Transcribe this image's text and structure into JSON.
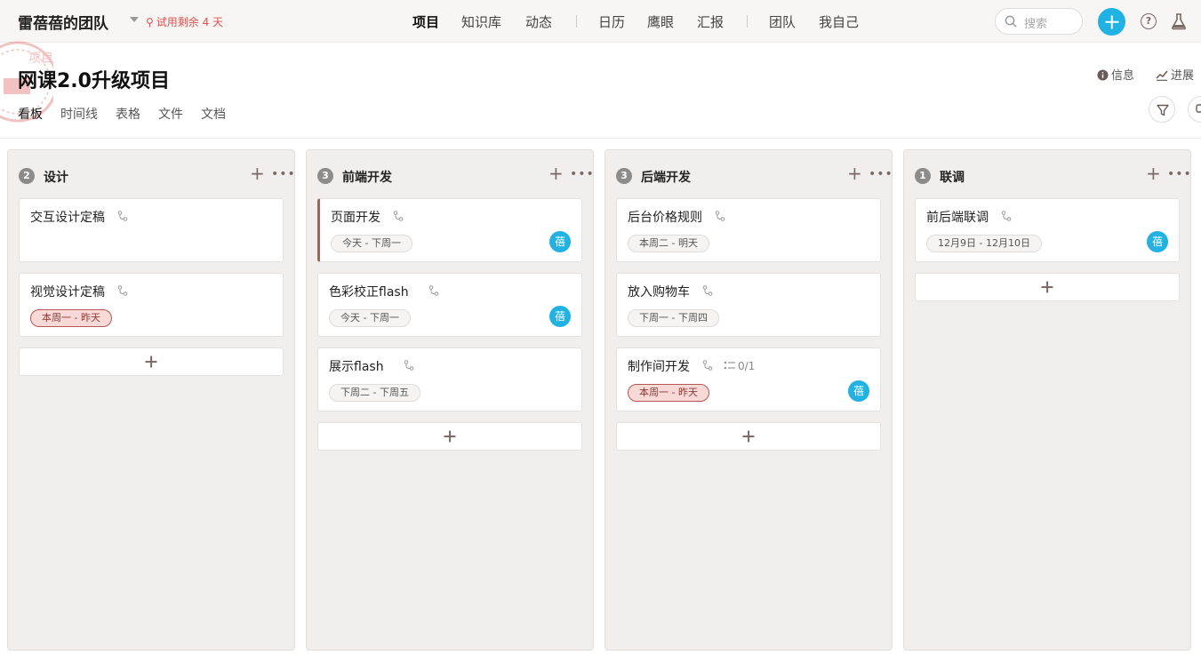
{
  "app": {
    "team_name": "雷蓓蓓的团队",
    "trial_text": "试用剩余 4 天",
    "nav": [
      "项目",
      "知识库",
      "动态",
      "日历",
      "鹰眼",
      "汇报",
      "团队",
      "我自己"
    ],
    "search_placeholder": "搜索",
    "help_label": "?",
    "accent_color": "#1fb2e2"
  },
  "project": {
    "title": "网课2.0升级项目",
    "tabs": [
      "看板",
      "时间线",
      "表格",
      "文件",
      "文档"
    ],
    "info_label": "信息",
    "progress_label": "进展"
  },
  "board": {
    "columns": [
      {
        "count": "2",
        "title": "设计",
        "cards": [
          {
            "title": "交互设计定稿"
          },
          {
            "title": "视觉设计定稿",
            "date": "本周一 - 昨天"
          }
        ]
      },
      {
        "count": "3",
        "title": "前端开发",
        "cards": [
          {
            "title": "页面开发",
            "date": "今天 - 下周一",
            "avatar": "蓓"
          },
          {
            "title": "色彩校正flash",
            "date": "今天 - 下周一",
            "avatar": "蓓"
          },
          {
            "title": "展示flash",
            "date": "下周二 - 下周五"
          }
        ]
      },
      {
        "count": "3",
        "title": "后端开发",
        "cards": [
          {
            "title": "后台价格规则",
            "date": "本周二 - 明天"
          },
          {
            "title": "放入购物车",
            "date": "下周一 - 下周四"
          },
          {
            "title": "制作间开发",
            "subtasks": "0/1",
            "date": "本周一 - 昨天",
            "avatar": "蓓"
          }
        ]
      },
      {
        "count": "1",
        "title": "联调",
        "cards": [
          {
            "title": "前后端联调",
            "date": "12月9日 - 12月10日",
            "avatar": "蓓"
          }
        ]
      }
    ]
  }
}
